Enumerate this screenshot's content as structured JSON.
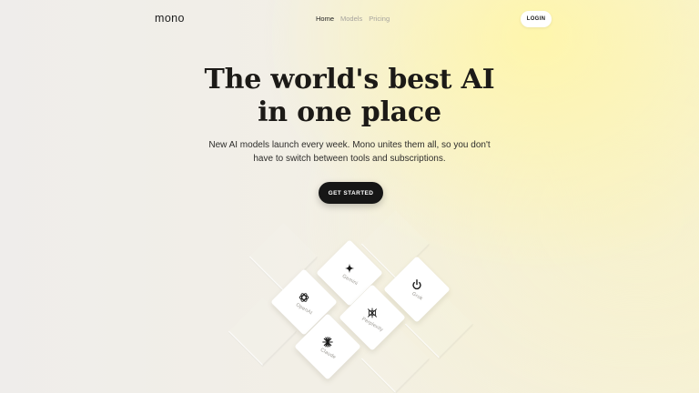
{
  "header": {
    "logo": "mono",
    "nav": [
      {
        "label": "Home",
        "active": true
      },
      {
        "label": "Models",
        "active": false
      },
      {
        "label": "Pricing",
        "active": false
      }
    ],
    "login_label": "LOGIN"
  },
  "hero": {
    "title_line1": "The world's best AI",
    "title_line2": "in one place",
    "subtitle_line1": "New AI models launch every week. Mono unites them all, so you don't",
    "subtitle_line2": "have to switch between tools and subscriptions.",
    "cta_label": "GET STARTED"
  },
  "models": [
    {
      "label": "Gemini",
      "icon": "gemini-icon"
    },
    {
      "label": "Grok",
      "icon": "grok-icon"
    },
    {
      "label": "OpenAI",
      "icon": "openai-icon"
    },
    {
      "label": "Perplexity",
      "icon": "perplexity-icon"
    },
    {
      "label": "Claude",
      "icon": "claude-icon"
    }
  ],
  "colors": {
    "accent_yellow": "#fff6aa",
    "button_dark": "#161616",
    "text_dark": "#1c1a17",
    "nav_muted": "#a7a49e"
  }
}
